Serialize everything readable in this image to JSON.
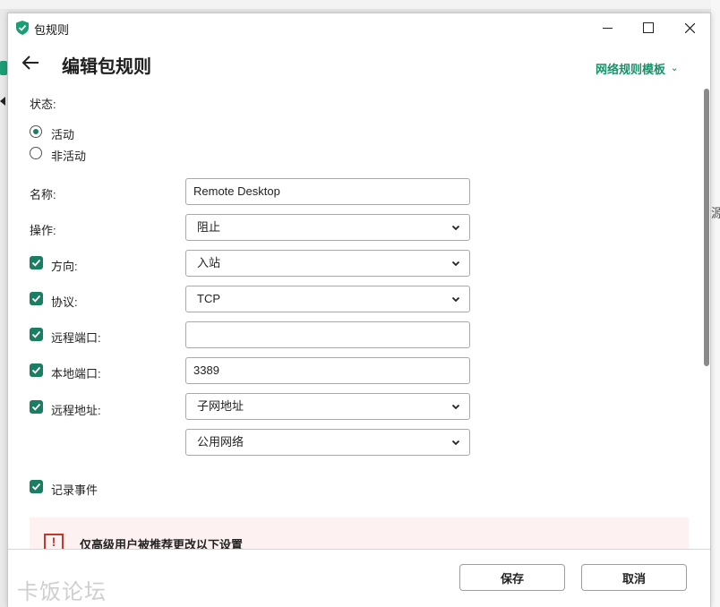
{
  "window": {
    "title": "包规则"
  },
  "header": {
    "title": "编辑包规则",
    "template_link": "网络规则模板"
  },
  "background": {
    "right_text": "源"
  },
  "status": {
    "label": "状态:",
    "options": [
      {
        "label": "活动",
        "selected": true
      },
      {
        "label": "非活动",
        "selected": false
      }
    ]
  },
  "form": {
    "name_label": "名称:",
    "name_value": "Remote Desktop",
    "action_label": "操作:",
    "action_value": "阻止",
    "direction_label": "方向:",
    "direction_value": "入站",
    "protocol_label": "协议:",
    "protocol_value": "TCP",
    "remote_port_label": "远程端口:",
    "remote_port_value": "",
    "local_port_label": "本地端口:",
    "local_port_value": "3389",
    "remote_address_label": "远程地址:",
    "remote_address_value": "子网地址",
    "network_value": "公用网络",
    "log_events_label": "记录事件"
  },
  "warning": {
    "text": "仅高级用户被推荐更改以下设置",
    "icon": "!"
  },
  "footer": {
    "save_label": "保存",
    "cancel_label": "取消"
  },
  "watermark": "卡饭论坛",
  "colors": {
    "accent": "#1b7d61",
    "link": "#1b8f6a",
    "warning_bg": "#fdf1f1",
    "warning_icon": "#c0392b"
  }
}
